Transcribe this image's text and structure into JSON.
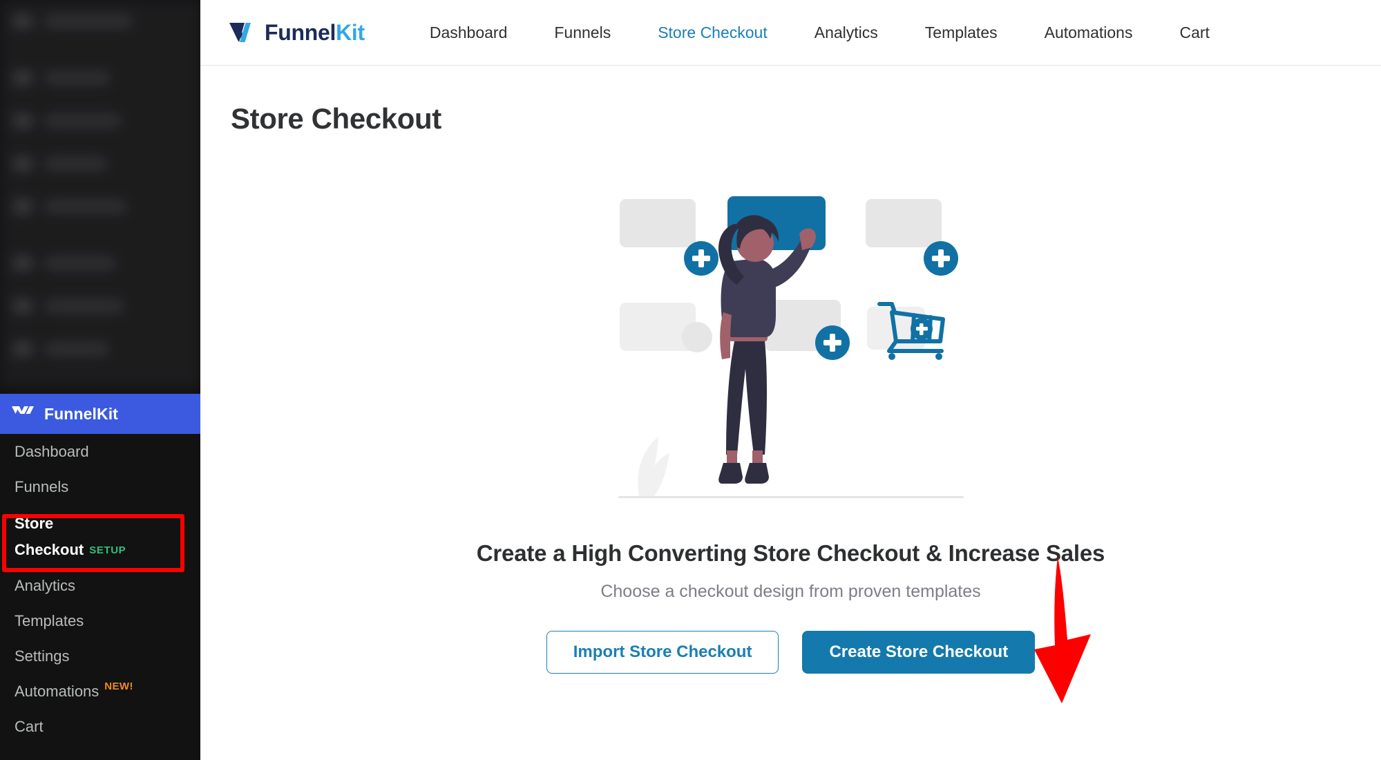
{
  "colors": {
    "brand_blue": "#3c5ae0",
    "accent_blue": "#1479ac",
    "link_active": "#1a7fb5",
    "badge_setup_green": "#2fc07a",
    "badge_new_orange": "#f28a1e",
    "annotation_red": "#fc0000",
    "sidebar_bg": "#121212",
    "illustration_blue": "#1171a5",
    "illustration_skin": "#a0616a",
    "illustration_hair": "#2f2e41"
  },
  "sidebar": {
    "brand": {
      "name": "FunnelKit",
      "logo_icon": "funnelkit-logo-icon"
    },
    "obscured_top_menu_rows": 8,
    "items": [
      {
        "label": "Dashboard",
        "badge": null,
        "active": false
      },
      {
        "label": "Funnels",
        "badge": null,
        "active": false
      },
      {
        "label": "Store Checkout",
        "badge": "SETUP",
        "badge_type": "setup",
        "active": true
      },
      {
        "label": "Analytics",
        "badge": null,
        "active": false
      },
      {
        "label": "Templates",
        "badge": null,
        "active": false
      },
      {
        "label": "Settings",
        "badge": null,
        "active": false
      },
      {
        "label": "Automations",
        "badge": "NEW!",
        "badge_type": "new",
        "active": false
      },
      {
        "label": "Cart",
        "badge": null,
        "active": false
      }
    ],
    "active_item_label_line1": "Store",
    "active_item_label_line2": "Checkout",
    "active_item_badge": "SETUP",
    "automations_label": "Automations",
    "automations_badge": "NEW!"
  },
  "topnav": {
    "logo": {
      "mark_icon": "funnelkit-mark-icon",
      "word_dark": "Funnel",
      "word_blue": "Kit"
    },
    "links": [
      {
        "label": "Dashboard",
        "active": false
      },
      {
        "label": "Funnels",
        "active": false
      },
      {
        "label": "Store Checkout",
        "active": true
      },
      {
        "label": "Analytics",
        "active": false
      },
      {
        "label": "Templates",
        "active": false
      },
      {
        "label": "Automations",
        "active": false
      },
      {
        "label": "Cart",
        "active": false
      }
    ]
  },
  "main": {
    "page_title": "Store Checkout",
    "illustration": {
      "name": "woman-arranging-checkout-template-blocks-illustration",
      "elements": [
        "placeholder-card-top-left",
        "selected-card-top-center",
        "placeholder-card-top-right",
        "placeholder-card-bottom-left",
        "placeholder-card-bottom-center",
        "placeholder-card-bottom-right",
        "add-plus-badge",
        "shopping-cart-add-icon",
        "ground-line",
        "plant-leaf"
      ]
    },
    "hero_title": "Create a High Converting Store Checkout & Increase Sales",
    "hero_subtitle": "Choose a checkout design from proven templates",
    "buttons": {
      "import_label": "Import Store Checkout",
      "create_label": "Create Store Checkout"
    }
  },
  "annotations": {
    "sidebar_box": "red-rectangle-around-store-checkout-sidebar-item",
    "arrow": "red-down-arrow-pointing-at-create-store-checkout-button"
  }
}
